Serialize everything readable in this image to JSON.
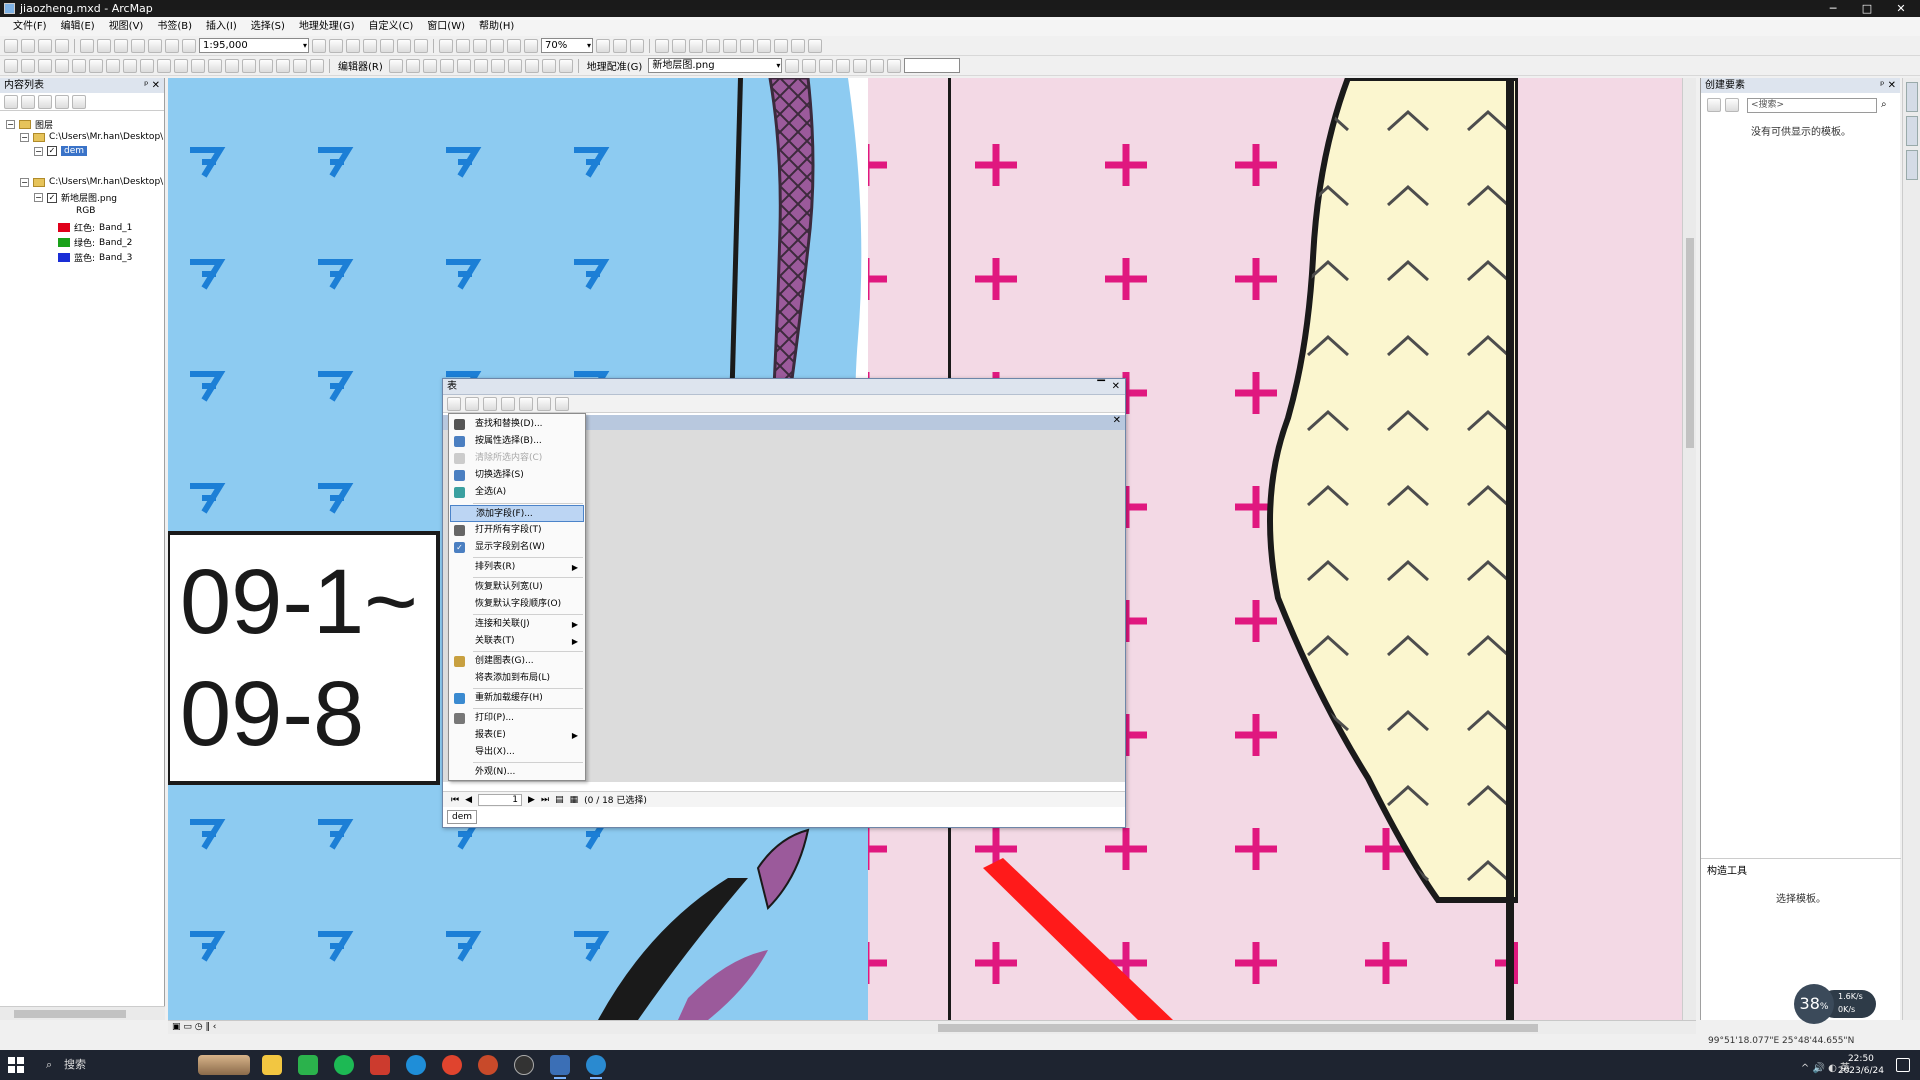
{
  "window": {
    "title": "jiaozheng.mxd - ArcMap",
    "min": "─",
    "max": "□",
    "close": "✕"
  },
  "menubar": [
    "文件(F)",
    "编辑(E)",
    "视图(V)",
    "书签(B)",
    "插入(I)",
    "选择(S)",
    "地理处理(G)",
    "自定义(C)",
    "窗口(W)",
    "帮助(H)"
  ],
  "toolbar": {
    "scale": "1:95,000",
    "zoom": "70%",
    "editor_label": "编辑器(R)",
    "georef_label": "地理配准(G)",
    "georef_layer": "新地层图.png"
  },
  "toc": {
    "title": "内容列表",
    "items": [
      {
        "label": "图层",
        "level": 0
      },
      {
        "label": "C:\\Users\\Mr.han\\Desktop\\",
        "level": 1
      },
      {
        "label": "dem",
        "level": 2,
        "selected": true
      },
      {
        "label": "C:\\Users\\Mr.han\\Desktop\\",
        "level": 1
      },
      {
        "label": "新地层图.png",
        "level": 2
      },
      {
        "label": "RGB",
        "level": 3
      }
    ],
    "bands": [
      {
        "color": "#e0001a",
        "name": "红色:",
        "band": "Band_1"
      },
      {
        "color": "#1aa11a",
        "name": "绿色:",
        "band": "Band_2"
      },
      {
        "color": "#1a2ed6",
        "name": "蓝色:",
        "band": "Band_3"
      }
    ]
  },
  "map": {
    "label_line1": "09-1~",
    "label_line2": "09-8"
  },
  "table_window": {
    "title": "表",
    "page": "1",
    "status": "(0 / 18 已选择)",
    "bottom_tab": "dem"
  },
  "context_menu": [
    {
      "label": "查找和替换(D)...",
      "icon": "binoculars-icon",
      "state": "normal"
    },
    {
      "label": "按属性选择(B)...",
      "icon": "select-by-attr-icon",
      "state": "normal"
    },
    {
      "label": "清除所选内容(C)",
      "icon": "clear-selection-icon",
      "state": "disabled"
    },
    {
      "label": "切换选择(S)",
      "icon": "switch-selection-icon",
      "state": "normal"
    },
    {
      "label": "全选(A)",
      "icon": "select-all-icon",
      "state": "normal"
    },
    {
      "label": "添加字段(F)...",
      "icon": "",
      "state": "highlight"
    },
    {
      "label": "打开所有字段(T)",
      "icon": "fields-icon",
      "state": "normal"
    },
    {
      "label": "显示字段别名(W)",
      "icon": "checkmark-icon",
      "state": "normal"
    },
    {
      "label": "排列表(R)",
      "icon": "",
      "state": "normal",
      "submenu": true
    },
    {
      "label": "恢复默认列宽(U)",
      "icon": "",
      "state": "normal"
    },
    {
      "label": "恢复默认字段顺序(O)",
      "icon": "",
      "state": "normal"
    },
    {
      "label": "连接和关联(J)",
      "icon": "",
      "state": "normal",
      "submenu": true
    },
    {
      "label": "关联表(T)",
      "icon": "",
      "state": "normal",
      "submenu": true
    },
    {
      "label": "创建图表(G)...",
      "icon": "chart-icon",
      "state": "normal"
    },
    {
      "label": "将表添加到布局(L)",
      "icon": "",
      "state": "normal"
    },
    {
      "label": "重新加载缓存(H)",
      "icon": "refresh-icon",
      "state": "normal"
    },
    {
      "label": "打印(P)...",
      "icon": "printer-icon",
      "state": "normal"
    },
    {
      "label": "报表(E)",
      "icon": "",
      "state": "normal",
      "submenu": true
    },
    {
      "label": "导出(X)...",
      "icon": "",
      "state": "normal"
    },
    {
      "label": "外观(N)...",
      "icon": "",
      "state": "normal"
    }
  ],
  "catalog": {
    "title": "创建要素",
    "search_placeholder": "<搜索>",
    "empty_msg": "没有可供显示的模板。",
    "tools_title": "构造工具",
    "tools_msg": "选择模板。"
  },
  "status": {
    "coords": "99°51'18.077\"E  25°48'44.655\"N"
  },
  "speed": {
    "value": "38",
    "unit": "%",
    "up": "1.6K/s",
    "down": "0K/s"
  },
  "taskbar": {
    "search": "搜索",
    "time": "22:50",
    "date": "2023/6/24"
  }
}
